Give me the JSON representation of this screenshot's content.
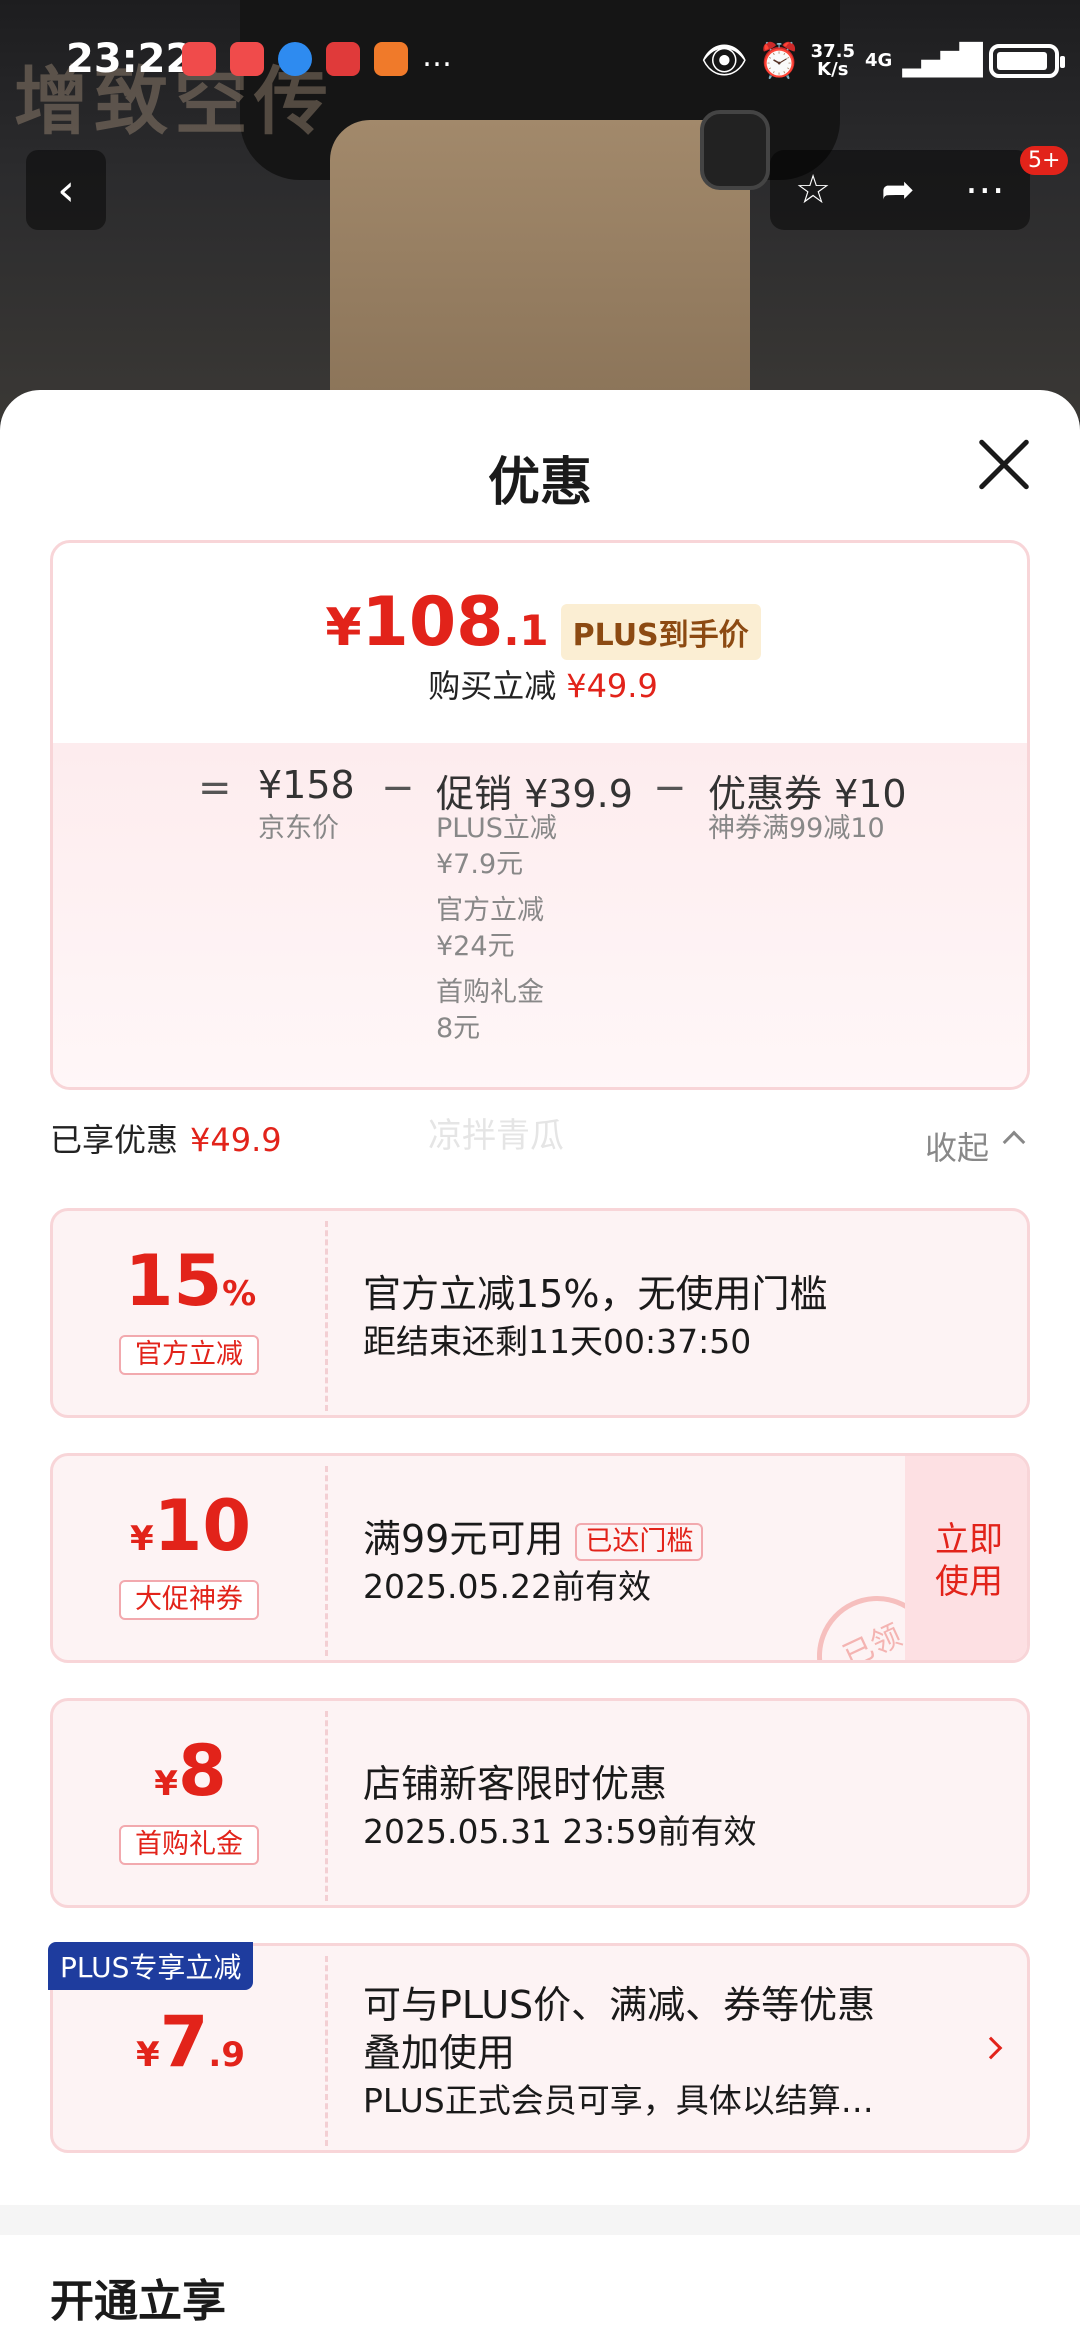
{
  "status_bar": {
    "time": "23:22",
    "speed_value": "37.5",
    "speed_unit": "K/s",
    "network": "4G"
  },
  "watermark": "增致空传",
  "nav": {
    "badge": "5+"
  },
  "sheet": {
    "title": "优惠",
    "summary": {
      "price_yen": "¥",
      "price_int": "108",
      "price_dec": ".1",
      "plus_tag": "PLUS到手价",
      "buy_reduce_label": "购买立减",
      "buy_reduce_value": "¥49.9",
      "equals": "=",
      "minus": "−",
      "jd_price": "¥158",
      "jd_price_label": "京东价",
      "promo": "促销 ¥39.9",
      "promo_items": [
        "PLUS立减",
        "¥7.9元",
        "官方立减",
        "¥24元",
        "首购礼金",
        "8元"
      ],
      "coupon": "优惠券 ¥10",
      "coupon_desc": "神券满99减10"
    },
    "enjoyed_label": "已享优惠",
    "enjoyed_value": "¥49.9",
    "ghost_text": "凉拌青瓜",
    "collapse_label": "收起",
    "coupons": [
      {
        "value": "15",
        "suffix": "%",
        "tag": "官方立减",
        "title": "官方立减15%，无使用门槛",
        "desc": "距结束还剩11天00:37:50"
      },
      {
        "prefix": "¥",
        "value": "10",
        "tag": "大促神券",
        "title": "满99元可用",
        "badge": "已达门槛",
        "desc": "2025.05.22前有效",
        "action": "立即\n使用",
        "stamp": "已领"
      },
      {
        "prefix": "¥",
        "value": "8",
        "tag": "首购礼金",
        "title": "店铺新客限时优惠",
        "desc": "2025.05.31 23:59前有效"
      },
      {
        "label": "PLUS专享立减",
        "prefix": "¥",
        "value": "7",
        "suffix": ".9",
        "title": "可与PLUS价、满减、券等优惠",
        "title2": "叠加使用",
        "desc": "PLUS正式会员可享，具体以结算…"
      }
    ],
    "open_title": "开通立享"
  },
  "colors": {
    "accent": "#e2231a",
    "plus_blue": "#1e3c9e",
    "card_bg": "#fdf3f4"
  }
}
